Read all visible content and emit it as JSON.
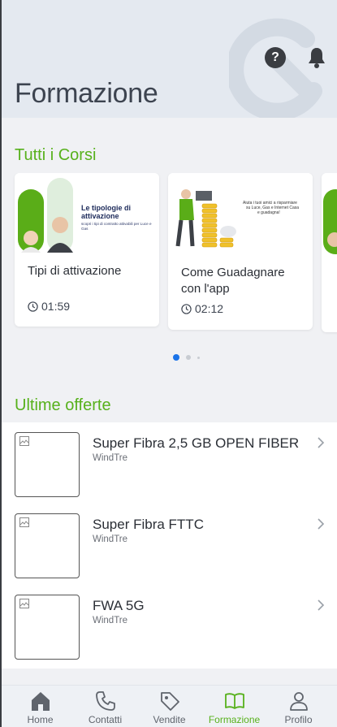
{
  "header": {
    "title": "Formazione",
    "help_icon": "question-icon",
    "bell_icon": "bell-icon"
  },
  "courses_section": {
    "title": "Tutti i Corsi"
  },
  "courses": [
    {
      "title": "Tipi di attivazione",
      "duration": "01:59",
      "thumb_heading": "Le tipologie di attivazione",
      "thumb_sub": "scopri i tipi di contratto attivabili per Luce e Gas"
    },
    {
      "title": "Come Guadagnare con l'app",
      "duration": "02:12",
      "thumb_text": "Aiuta i tuoi amici a risparmiare su Luce, Gas e Internet Casa e guadagna!"
    }
  ],
  "carousel": {
    "pages": 3,
    "active": 0
  },
  "offers_section": {
    "title": "Ultime offerte"
  },
  "offers": [
    {
      "name": "Super Fibra 2,5 GB OPEN FIBER",
      "brand": "WindTre"
    },
    {
      "name": "Super Fibra FTTC",
      "brand": "WindTre"
    },
    {
      "name": "FWA 5G",
      "brand": "WindTre"
    }
  ],
  "tabs": [
    {
      "label": "Home",
      "icon": "home-icon"
    },
    {
      "label": "Contatti",
      "icon": "phone-icon"
    },
    {
      "label": "Vendite",
      "icon": "tag-icon"
    },
    {
      "label": "Formazione",
      "icon": "book-icon",
      "active": true
    },
    {
      "label": "Profilo",
      "icon": "user-icon"
    }
  ],
  "colors": {
    "accent": "#57b11c",
    "dark": "#3a3d42",
    "header_bg": "#e4e9f0",
    "page_bg": "#f0f1f4"
  }
}
